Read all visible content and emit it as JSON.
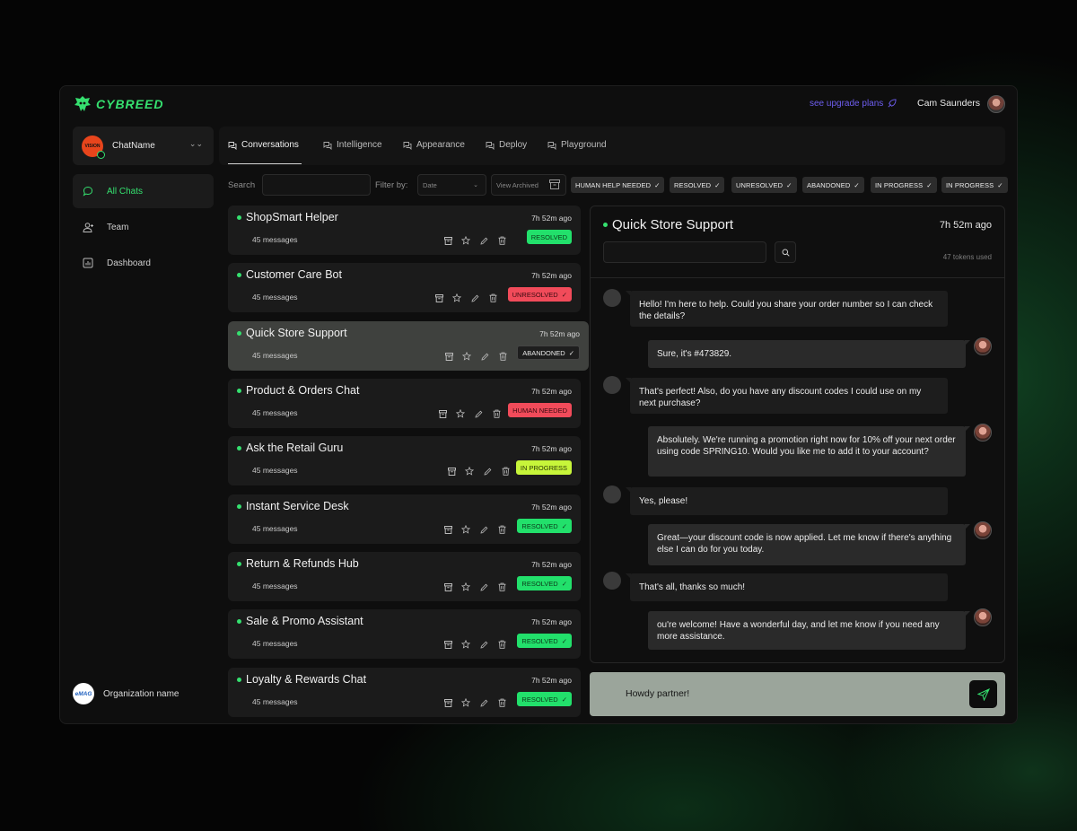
{
  "header": {
    "brand": "CYBREED",
    "upgrade_link": "see upgrade plans",
    "user_name": "Cam Saunders"
  },
  "sidebar": {
    "chat_select": {
      "name": "ChatName",
      "avatar_text": "VISION"
    },
    "items": [
      {
        "label": "All Chats",
        "icon": "chat-bubble-icon",
        "active": true
      },
      {
        "label": "Team",
        "icon": "user-add-icon",
        "active": false
      },
      {
        "label": "Dashboard",
        "icon": "dashboard-icon",
        "active": false
      }
    ],
    "org": {
      "name": "Organization name",
      "logo_text": "eMAG"
    }
  },
  "tabs": [
    {
      "label": "Conversations",
      "active": true
    },
    {
      "label": "Intelligence",
      "active": false
    },
    {
      "label": "Appearance",
      "active": false
    },
    {
      "label": "Deploy",
      "active": false
    },
    {
      "label": "Playground",
      "active": false
    }
  ],
  "filters": {
    "search_label": "Search",
    "filter_label": "Filter by:",
    "date_placeholder": "Date",
    "view_archived": "View Archived",
    "chips": [
      "HUMAN HELP NEEDED",
      "RESOLVED",
      "UNRESOLVED",
      "ABANDONED",
      "IN PROGRESS",
      "IN PROGRESS"
    ]
  },
  "conversations": [
    {
      "title": "ShopSmart Helper",
      "time": "7h 52m ago",
      "count": "45 messages",
      "status": "RESOLVED",
      "check": false
    },
    {
      "title": "Customer Care Bot",
      "time": "7h 52m ago",
      "count": "45 messages",
      "status": "UNRESOLVED",
      "check": true
    },
    {
      "title": "Quick Store Support",
      "time": "7h 52m ago",
      "count": "45 messages",
      "status": "ABANDONED",
      "check": true
    },
    {
      "title": "Product & Orders Chat",
      "time": "7h 52m ago",
      "count": "45 messages",
      "status": "HUMAN NEEDED",
      "check": false
    },
    {
      "title": "Ask the Retail Guru",
      "time": "7h 52m ago",
      "count": "45 messages",
      "status": "IN PROGRESS",
      "check": false
    },
    {
      "title": "Instant Service Desk",
      "time": "7h 52m ago",
      "count": "45 messages",
      "status": "RESOLVED",
      "check": true
    },
    {
      "title": "Return & Refunds Hub",
      "time": "7h 52m ago",
      "count": "45 messages",
      "status": "RESOLVED",
      "check": true
    },
    {
      "title": "Sale & Promo Assistant",
      "time": "7h 52m ago",
      "count": "45 messages",
      "status": "RESOLVED",
      "check": true
    },
    {
      "title": "Loyalty & Rewards Chat",
      "time": "7h 52m ago",
      "count": "45 messages",
      "status": "RESOLVED",
      "check": true
    }
  ],
  "chat": {
    "title": "Quick Store Support",
    "time": "7h 52m ago",
    "tokens": "47 tokens used",
    "messages": [
      {
        "role": "bot",
        "text": "Hello! I'm here to help. Could you share your order number so I can check the details?"
      },
      {
        "role": "user",
        "text": "Sure, it's #473829."
      },
      {
        "role": "bot",
        "text": "That's perfect! Also, do you have any discount codes I could use on my next purchase?"
      },
      {
        "role": "user",
        "text": " Absolutely. We're running a promotion right now for 10% off your next order using code SPRING10. Would you like me to add it to your account?"
      },
      {
        "role": "bot",
        "text": "Yes, please!"
      },
      {
        "role": "user",
        "text": "Great—your discount code is now applied. Let me know if there's anything else I can do for you today."
      },
      {
        "role": "bot",
        "text": "That's all, thanks so much!"
      },
      {
        "role": "user",
        "text": "ou're welcome! Have a wonderful day, and let me know if you need any more assistance."
      }
    ],
    "composer_text": "Howdy partner!"
  },
  "colors": {
    "accent": "#35e06f",
    "resolved": "#22e06b",
    "unresolved": "#f14b5a",
    "in_progress": "#c7f53a",
    "link": "#6e5ef0"
  }
}
